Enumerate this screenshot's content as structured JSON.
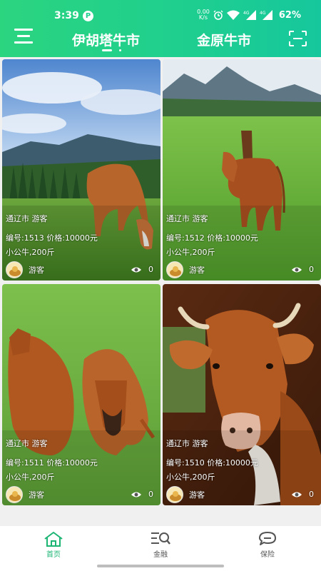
{
  "status_bar": {
    "time": "3:39",
    "app_icon": "P",
    "net_speed_value": "0.00",
    "net_speed_unit": "K/s",
    "battery": "62%",
    "icons": [
      "alarm-icon",
      "wifi-icon",
      "signal-4g-icon",
      "signal-4g-icon"
    ]
  },
  "header": {
    "tabs": [
      {
        "label": "伊胡塔牛市",
        "active": true
      },
      {
        "label": "金原牛市",
        "active": false
      }
    ],
    "accent_gradient": [
      "#2bd47f",
      "#16c79d"
    ]
  },
  "cards": [
    {
      "location": "通辽市 游客",
      "line1": "编号:1513 价格:10000元",
      "line2": "小公牛,200斤",
      "user": "游客",
      "views": "0",
      "image": "cow-in-mountain-pasture"
    },
    {
      "location": "通辽市 游客",
      "line1": "编号:1512 价格:10000元",
      "line2": "小公牛,200斤",
      "user": "游客",
      "views": "0",
      "image": "cow-in-green-field"
    },
    {
      "location": "通辽市 游客",
      "line1": "编号:1511 价格:10000元",
      "line2": "小公牛,200斤",
      "user": "游客",
      "views": "0",
      "image": "two-cows-lying-on-grass"
    },
    {
      "location": "通辽市 游客",
      "line1": "编号:1510 价格:10000元",
      "line2": "小公牛,200斤",
      "user": "游客",
      "views": "0",
      "image": "cow-head-closeup"
    }
  ],
  "bottom_nav": [
    {
      "label": "首页",
      "icon": "home-icon",
      "active": true
    },
    {
      "label": "金融",
      "icon": "finance-search-icon",
      "active": false
    },
    {
      "label": "保险",
      "icon": "chat-bubble-icon",
      "active": false
    }
  ],
  "colors": {
    "active_nav": "#1cb574",
    "inactive_nav": "#555555"
  }
}
